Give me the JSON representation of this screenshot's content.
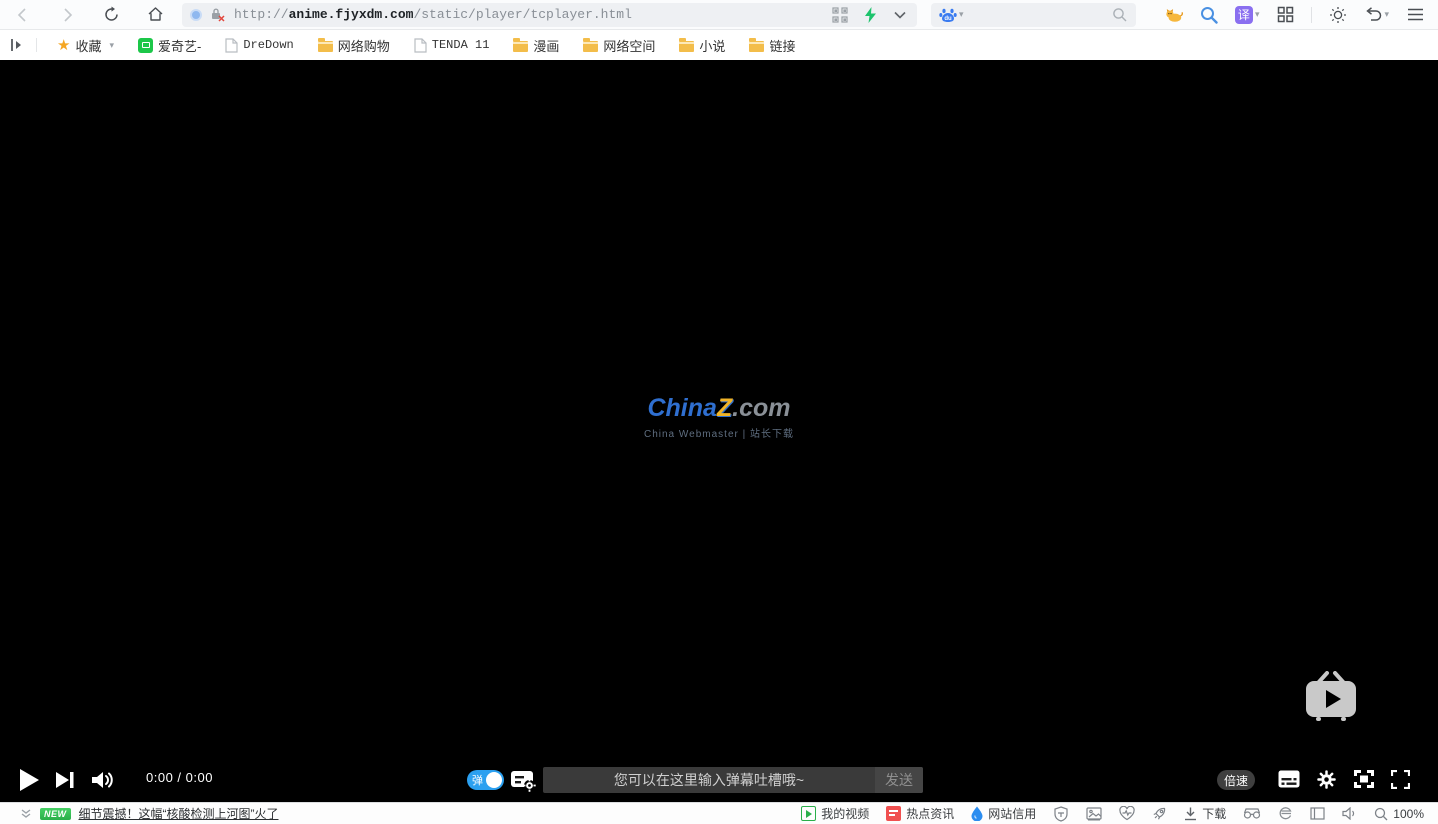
{
  "browser": {
    "url": {
      "scheme": "http://",
      "host": "anime.fjyxdm.com",
      "path": "/static/player/tcplayer.html"
    },
    "translate_label": "译"
  },
  "bookmarks": {
    "favorites_label": "收藏",
    "items": [
      {
        "label": "爱奇艺-",
        "type": "iqiyi"
      },
      {
        "label": "DreDown",
        "type": "page"
      },
      {
        "label": "网络购物",
        "type": "folder"
      },
      {
        "label": "TENDA 11",
        "type": "page"
      },
      {
        "label": "漫画",
        "type": "folder"
      },
      {
        "label": "网络空间",
        "type": "folder"
      },
      {
        "label": "小说",
        "type": "folder"
      },
      {
        "label": "链接",
        "type": "folder"
      }
    ]
  },
  "player": {
    "time": "0:00 / 0:00",
    "danmu_toggle_label": "弹",
    "danmu_placeholder": "您可以在这里输入弹幕吐槽哦~",
    "send_label": "发送",
    "speed_label": "倍速"
  },
  "watermark": {
    "part_china": "China",
    "part_z": "Z",
    "part_com": ".com",
    "tagline": "China Webmaster | 站长下载"
  },
  "statusbar": {
    "badge": "NEW",
    "news": "细节震撼！这幅“核酸检测上河图”火了",
    "my_video": "我的视频",
    "hot_news": "热点资讯",
    "site_credit": "网站信用",
    "download": "下载",
    "zoom": "100%"
  },
  "colors": {
    "toggle_blue": "#2ba0f0",
    "lightning_green": "#1dc36c",
    "translate_purple": "#8a6ff0",
    "folder_yellow": "#f3bd4a",
    "star_orange": "#f5a623",
    "new_green": "#2aaf4a",
    "hot_red": "#f05050",
    "credit_blue": "#2b8df0",
    "iqiyi_green": "#1cc749"
  }
}
